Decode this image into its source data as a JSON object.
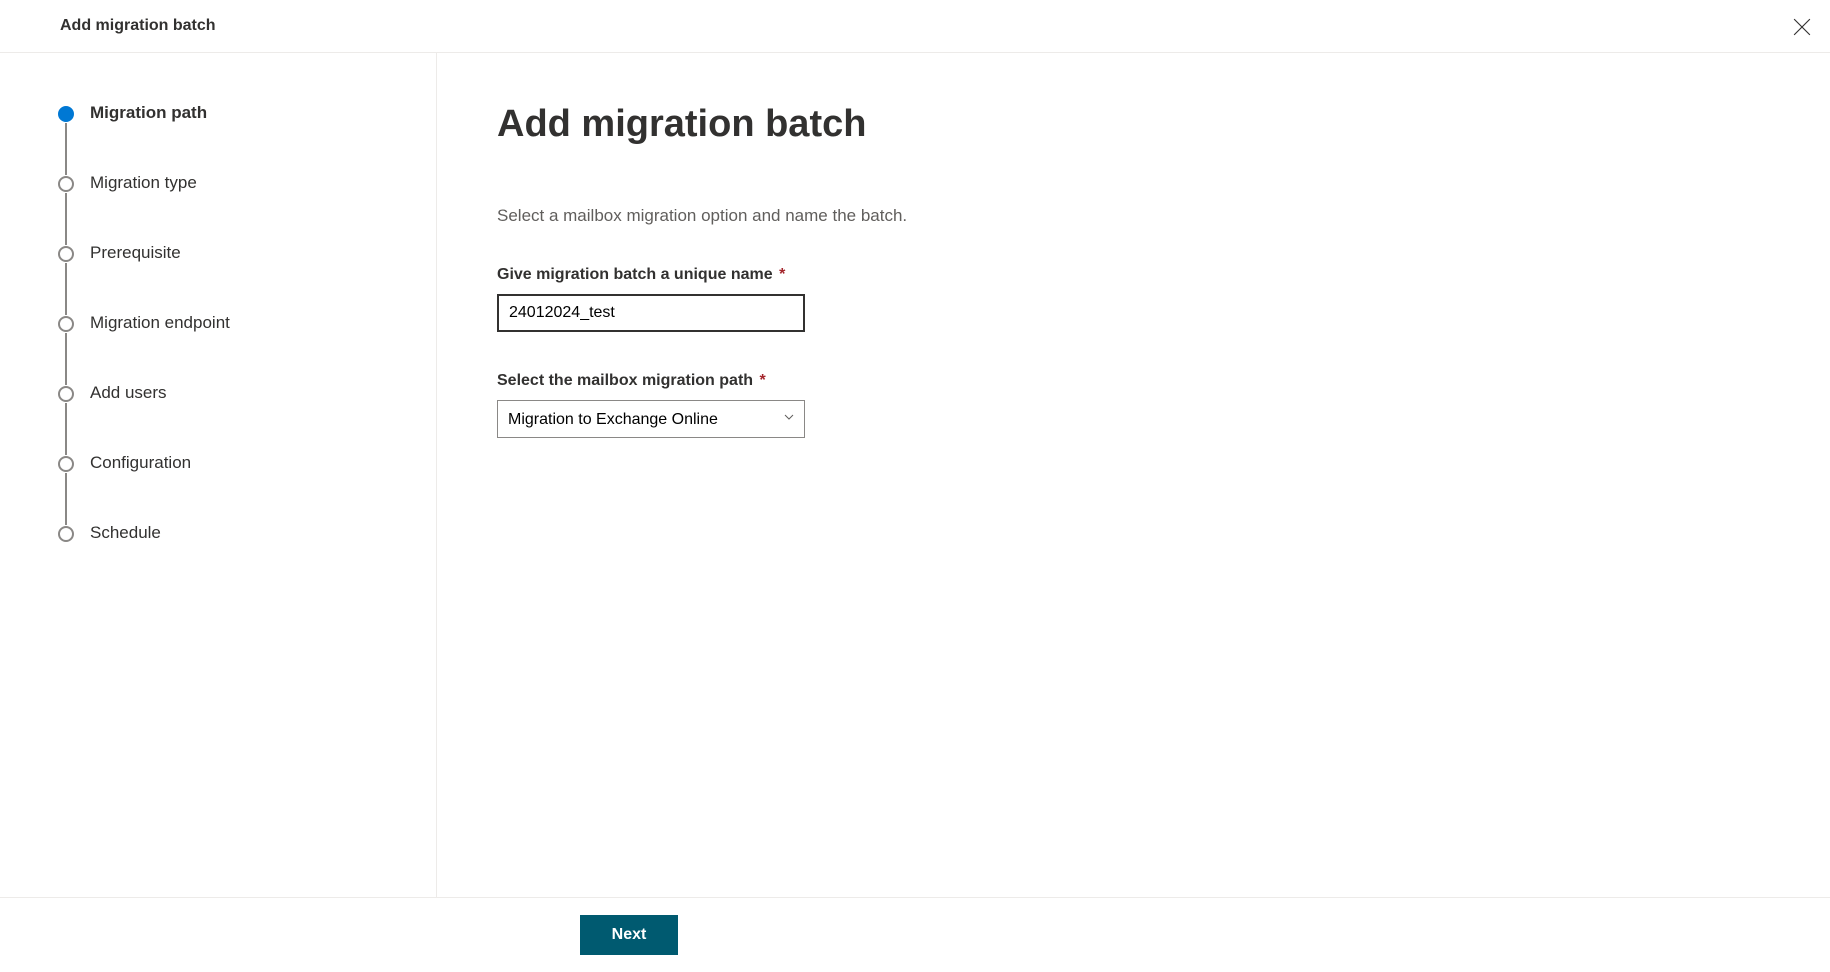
{
  "header": {
    "title": "Add migration batch"
  },
  "sidebar": {
    "steps": [
      {
        "label": "Migration path",
        "active": true
      },
      {
        "label": "Migration type",
        "active": false
      },
      {
        "label": "Prerequisite",
        "active": false
      },
      {
        "label": "Migration endpoint",
        "active": false
      },
      {
        "label": "Add users",
        "active": false
      },
      {
        "label": "Configuration",
        "active": false
      },
      {
        "label": "Schedule",
        "active": false
      }
    ]
  },
  "main": {
    "title": "Add migration batch",
    "subtitle": "Select a mailbox migration option and name the batch.",
    "nameField": {
      "label": "Give migration batch a unique name",
      "value": "24012024_test"
    },
    "pathField": {
      "label": "Select the mailbox migration path",
      "value": "Migration to Exchange Online"
    }
  },
  "footer": {
    "nextLabel": "Next"
  }
}
